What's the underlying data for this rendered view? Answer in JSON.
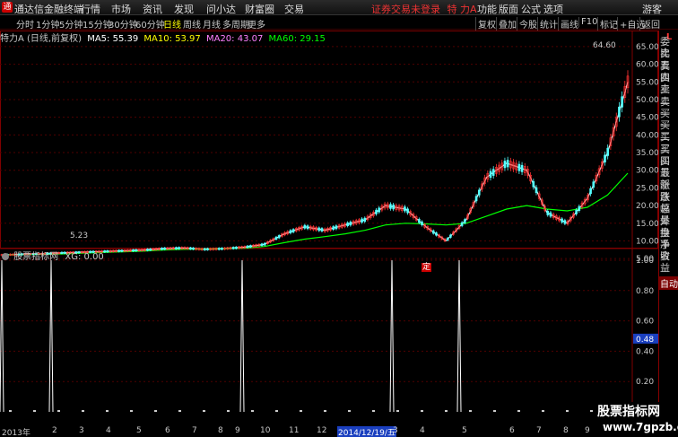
{
  "app": {
    "logo": "通",
    "title": "通达信金融终端"
  },
  "menu": [
    "行情",
    "市场",
    "资讯",
    "发现",
    "问小达",
    "财富圈",
    "交易"
  ],
  "notice": "证券交易未登录",
  "stock_name_top": "特 力A",
  "menu_right": [
    "功能",
    "版面",
    "公式",
    "选项",
    "游客"
  ],
  "periods": [
    "分时",
    "1分钟",
    "5分钟",
    "15分钟",
    "30分钟",
    "60分钟",
    "日线",
    "周线",
    "月线",
    "多周期",
    "更多"
  ],
  "active_period": "日线",
  "toolbar_right": [
    "复权",
    "叠加",
    "今股",
    "统计",
    "画线",
    "F10",
    "标记",
    "+自选",
    "返回"
  ],
  "info": {
    "name": "特力A (日线,前复权)",
    "ma5": "MA5: 55.39",
    "ma10": "MA10: 53.97",
    "ma20": "MA20: 43.07",
    "ma60": "MA60: 29.15"
  },
  "indicator": {
    "name": "股票指标网",
    "xg": "XG: 0.00"
  },
  "price_axis": [
    "65.00",
    "60.00",
    "55.00",
    "50.00",
    "45.00",
    "40.00",
    "35.00",
    "30.00",
    "25.00",
    "20.00",
    "15.00",
    "10.00",
    "5.00"
  ],
  "indicator_axis": [
    "1.00",
    "0.80",
    "0.60",
    "0.48",
    "0.40",
    "0.20"
  ],
  "highlight_value": "0.48",
  "price_annotations": {
    "high": "64.60",
    "low": "5.23",
    "marker": "定"
  },
  "side_items": [
    "委比",
    "卖五",
    "卖四",
    "卖三",
    "卖二",
    "卖一",
    "买一",
    "买二",
    "买三",
    "买四",
    "买五",
    "最新",
    "涨跌",
    "涨幅",
    "总量",
    "外盘",
    "换手",
    "净资",
    "收益"
  ],
  "side_top": "L",
  "side_auto": "自动",
  "dates": [
    "2013年",
    "2",
    "3",
    "4",
    "5",
    "6",
    "7",
    "8",
    "9",
    "10",
    "11",
    "12",
    "2014/12/19/五",
    "3",
    "4",
    "5",
    "6",
    "7",
    "8",
    "9"
  ],
  "watermark": {
    "line1": "股票指标网",
    "line2": "www.7gpzb.com"
  },
  "colors": {
    "up": "#ff3232",
    "down": "#54ffff",
    "ma5": "#ffffff",
    "ma10": "#ffff00",
    "ma20": "#ff80ff",
    "ma60": "#00ff00",
    "grid": "#800000"
  },
  "chart_data": {
    "type": "line",
    "title": "特力A (日线,前复权)",
    "xlabel": "",
    "ylabel": "",
    "ylim": [
      3,
      67
    ],
    "series": [
      {
        "name": "MA5",
        "values": [
          6,
          6.2,
          6.3,
          6.6,
          6.8,
          7.0,
          7.2,
          7.4,
          7.8,
          8.0,
          7.6,
          7.8,
          8.2,
          9,
          12,
          14,
          13,
          14.5,
          16,
          20,
          19,
          14,
          10,
          16,
          28,
          32,
          30,
          18,
          15,
          22,
          35,
          55
        ]
      },
      {
        "name": "MA60",
        "values": [
          6,
          6.1,
          6.2,
          6.3,
          6.5,
          6.7,
          6.9,
          7.1,
          7.4,
          7.6,
          7.7,
          7.8,
          7.9,
          8.4,
          9.5,
          10.5,
          11.2,
          12,
          13,
          14.5,
          15,
          14.8,
          14.5,
          15,
          17,
          19,
          20,
          19,
          18.5,
          19.5,
          23,
          29.15
        ]
      }
    ],
    "indicator_spikes": [
      0.0,
      1.0,
      1.0,
      1.0,
      1.0,
      1.0
    ]
  }
}
